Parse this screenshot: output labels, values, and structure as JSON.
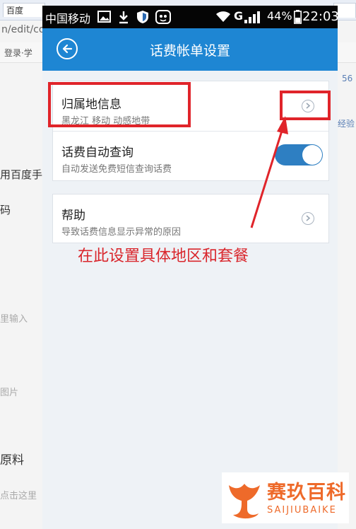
{
  "background": {
    "tab_left_label": "百度",
    "url_fragment": "n/edit/co",
    "login_text": "登录·学",
    "right_number": "56",
    "right_label": "经验",
    "side_text_1": "用百度手",
    "side_text_2": "码",
    "side_text_3": "里输入",
    "side_text_4": "图片",
    "side_text_5": "原料",
    "side_text_6": "点击这里"
  },
  "status_bar": {
    "carrier": "中国移动",
    "network": "G",
    "battery": "44%",
    "time": "22:03"
  },
  "title_bar": {
    "title": "话费帐单设置"
  },
  "settings": {
    "location": {
      "label": "归属地信息",
      "detail": "黑龙江 移动 动感地带"
    },
    "auto_query": {
      "label": "话费自动查询",
      "detail": "自动发送免费短信查询话费",
      "enabled": true
    },
    "help": {
      "label": "帮助",
      "detail": "导致话费信息显示异常的原因"
    }
  },
  "annotation": {
    "text": "在此设置具体地区和套餐",
    "color": "#e0242a"
  },
  "watermark": {
    "brand_cn": "赛玖百科",
    "brand_en": "SAIJIUBAIKE",
    "color": "#ee6a2a"
  },
  "colors": {
    "titlebar": "#1e86d3",
    "toggle_on": "#2e7fc2"
  }
}
